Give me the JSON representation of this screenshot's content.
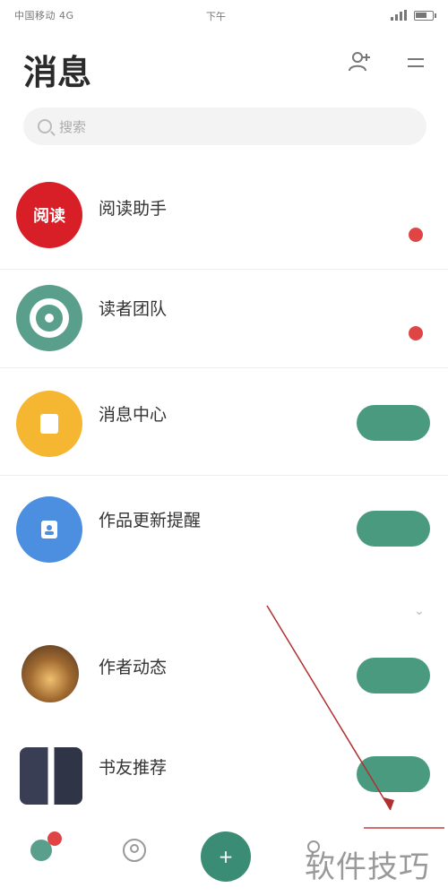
{
  "status_bar": {
    "carrier": "中国移动 4G",
    "time": "下午",
    "battery_icon": "battery-icon",
    "signal_icon": "signal-icon"
  },
  "header": {
    "title": "消息",
    "add_icon": "person-add-icon",
    "menu_icon": "menu-icon"
  },
  "search": {
    "placeholder": "搜索",
    "icon": "search-icon"
  },
  "conversations": [
    {
      "name": "阅读助手",
      "preview": "",
      "time": "",
      "avatar_color": "#d81e26",
      "avatar_text": "阅读",
      "unread": true
    },
    {
      "name": "读者团队",
      "preview": "",
      "time": "",
      "avatar_color": "#5a9e8c",
      "avatar_text": "",
      "unread": true
    },
    {
      "name": "消息中心",
      "preview": "",
      "button": "",
      "avatar_color": "#f5b731",
      "avatar_text": ""
    },
    {
      "name": "作品更新提醒",
      "preview": "",
      "button": "",
      "avatar_color": "#4c8fe0",
      "avatar_text": ""
    },
    {
      "name": "作者动态",
      "preview": "",
      "button": "",
      "avatar_color": "#7a5a3a",
      "avatar_text": ""
    },
    {
      "name": "书友推荐",
      "preview": "",
      "button": "",
      "avatar_color": "#2f3447",
      "avatar_text": ""
    }
  ],
  "section_label": "",
  "bottom_nav": {
    "items": [
      {
        "label": "",
        "icon": "chat-icon",
        "badge": true
      },
      {
        "label": "",
        "icon": "contacts-icon"
      },
      {
        "label": "",
        "icon": "plus-icon"
      },
      {
        "label": "",
        "icon": "profile-icon"
      }
    ]
  },
  "watermark": "软件技巧",
  "colors": {
    "accent": "#4a9a80",
    "badge": "#e04545"
  }
}
